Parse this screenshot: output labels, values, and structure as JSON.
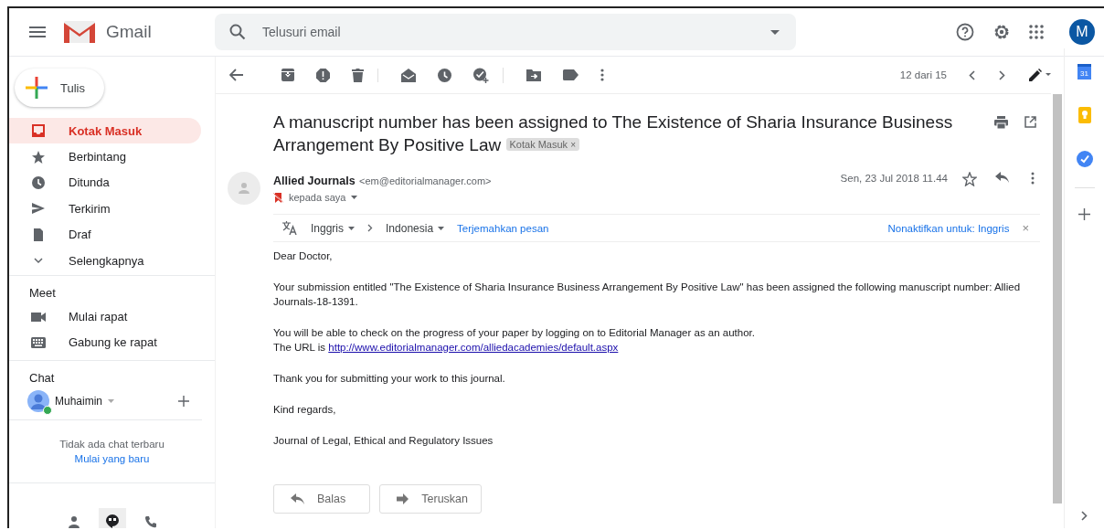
{
  "header": {
    "app_name": "Gmail",
    "search": {
      "placeholder": "Telusuri email"
    },
    "avatar_letter": "M"
  },
  "compose": {
    "label": "Tulis"
  },
  "sidebar": {
    "items": [
      {
        "label": "Kotak Masuk",
        "selected": true
      },
      {
        "label": "Berbintang",
        "selected": false
      },
      {
        "label": "Ditunda",
        "selected": false
      },
      {
        "label": "Terkirim",
        "selected": false
      },
      {
        "label": "Draf",
        "selected": false
      },
      {
        "label": "Selengkapnya",
        "selected": false
      }
    ],
    "meet": {
      "title": "Meet",
      "items": [
        "Mulai rapat",
        "Gabung ke rapat"
      ]
    },
    "chat": {
      "title": "Chat",
      "user": "Muhaimin",
      "online": true,
      "empty_text": "Tidak ada chat terbaru",
      "start_link": "Mulai yang baru"
    },
    "chat_tabs": [
      {
        "selected": false
      },
      {
        "selected": true
      },
      {
        "selected": false
      }
    ]
  },
  "toolbar": {
    "counter": "12 dari 15"
  },
  "message": {
    "subject": "A manuscript number has been assigned to The Existence of Sharia Insurance Business Arrangement By Positive Law",
    "label_chip": "Kotak Masuk",
    "label_close": "×",
    "sender_name": "Allied Journals",
    "sender_email": "<em@editorialmanager.com>",
    "recipient": "kepada saya",
    "date": "Sen, 23 Jul 2018 11.44",
    "starred": false,
    "translate": {
      "from": "Inggris",
      "to": "Indonesia",
      "action": "Terjemahkan pesan",
      "disable": "Nonaktifkan untuk: Inggris",
      "close": "×"
    },
    "body": [
      {
        "text": "Dear  Doctor,"
      },
      {
        "text": "Your submission entitled \"The Existence of Sharia Insurance Business Arrangement By Positive Law\" has been assigned the following manuscript number: Allied Journals-18-1391."
      },
      {
        "text": "You will be able to check on the progress of your paper by logging on to Editorial Manager as an author.",
        "link_prefix": "The URL is ",
        "link": "http://www.editorialmanager.com/alliedacademies/default.aspx"
      },
      {
        "text": "Thank you for submitting your work to this journal."
      },
      {
        "text": "Kind regards,"
      },
      {
        "text": "Journal of Legal, Ethical and Regulatory Issues"
      }
    ],
    "actions": [
      "Balas",
      "Teruskan"
    ]
  },
  "right_rail": {
    "calendar_day": "31"
  }
}
